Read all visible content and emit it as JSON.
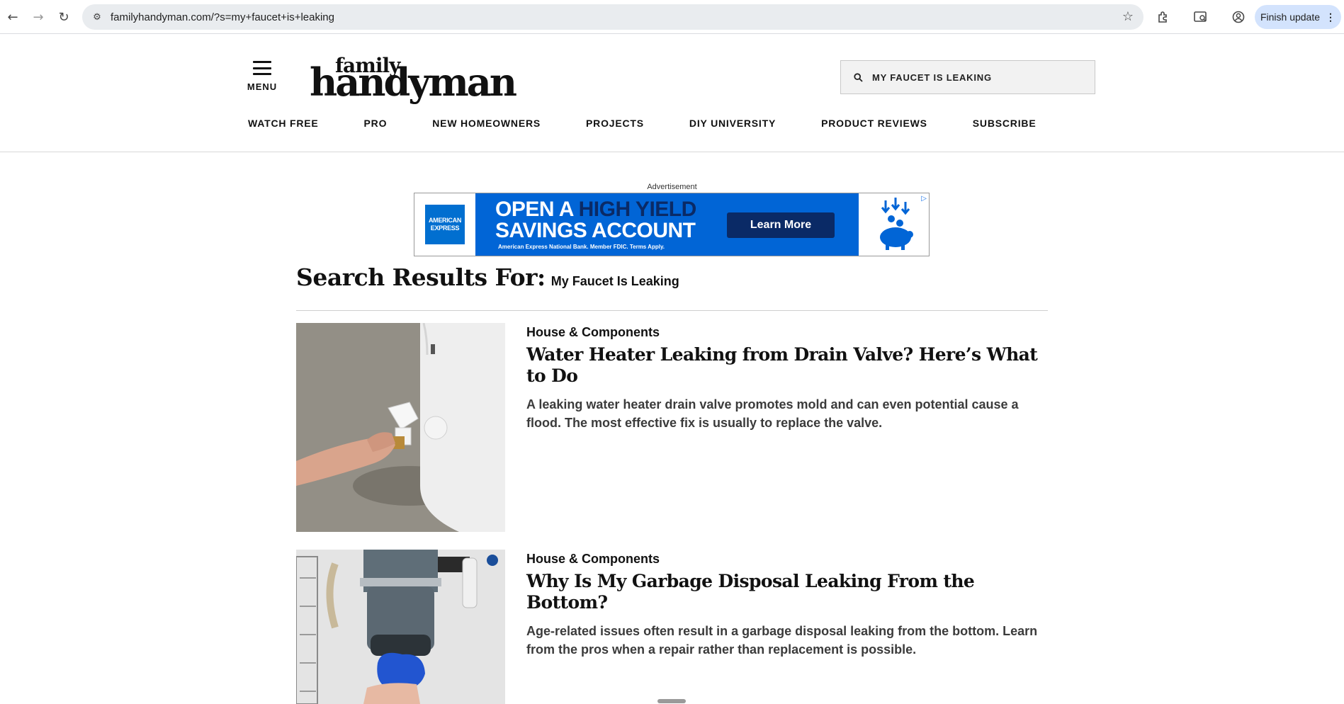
{
  "browser": {
    "url": "familyhandyman.com/?s=my+faucet+is+leaking",
    "finish_update_label": "Finish update",
    "icons": [
      "back-icon",
      "forward-icon",
      "reload-icon",
      "site-info-icon",
      "bookmark-star-icon",
      "extensions-icon",
      "tab-search-icon",
      "profile-icon",
      "more-icon"
    ]
  },
  "header": {
    "menu_label": "MENU",
    "logo_small": "family",
    "logo_big": "handyman",
    "search_value": "MY FAUCET IS LEAKING"
  },
  "nav": {
    "items": [
      "WATCH FREE",
      "PRO",
      "NEW HOMEOWNERS",
      "PROJECTS",
      "DIY UNIVERSITY",
      "PRODUCT REVIEWS",
      "SUBSCRIBE"
    ]
  },
  "ad": {
    "label": "Advertisement",
    "brand": "AMERICAN EXPRESS",
    "headline_1a": "OPEN A ",
    "headline_1b": "HIGH YIELD",
    "headline_2": "SAVINGS ACCOUNT",
    "fine_print": "American Express National Bank. Member FDIC. Terms Apply.",
    "cta": "Learn More",
    "colors": {
      "primary": "#0165d6",
      "dark": "#0a2a66"
    }
  },
  "results": {
    "heading": "Search Results For:",
    "term": "My Faucet Is Leaking",
    "items": [
      {
        "category": "House & Components",
        "title": "Water Heater Leaking from Drain Valve? Here’s What to Do",
        "description": "A leaking water heater drain valve promotes mold and can even potential cause a flood. The most effective fix is usually to replace the valve."
      },
      {
        "category": "House & Components",
        "title": "Why Is My Garbage Disposal Leaking From the Bottom?",
        "description": "Age-related issues often result in a garbage disposal leaking from the bottom. Learn from the pros when a repair rather than replacement is possible."
      }
    ]
  }
}
